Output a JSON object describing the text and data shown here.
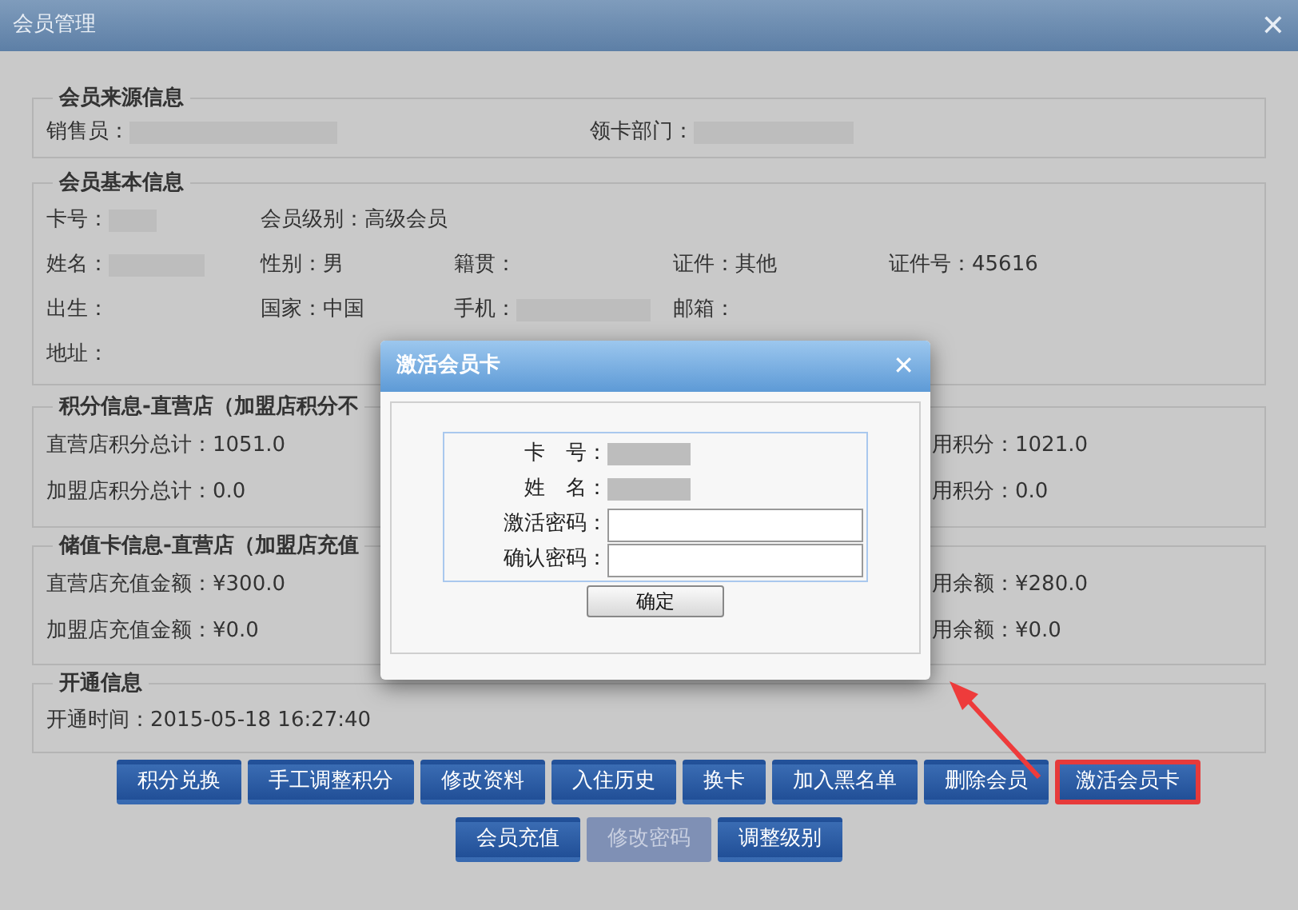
{
  "window": {
    "title": "会员管理",
    "close": "✕"
  },
  "source": {
    "legend": "会员来源信息",
    "fields": [
      {
        "label": "销售员："
      },
      {
        "label": "领卡部门："
      }
    ]
  },
  "basic": {
    "legend": "会员基本信息",
    "rows": [
      [
        {
          "label": "卡号：",
          "redacted": true
        },
        {
          "label": "会员级别：高级会员"
        }
      ],
      [
        {
          "label": "姓名：",
          "redacted": true
        },
        {
          "label": "性别：男"
        },
        {
          "label": "籍贯："
        },
        {
          "label": "证件：其他"
        },
        {
          "label": "证件号：45616"
        }
      ],
      [
        {
          "label": "出生："
        },
        {
          "label": "国家：中国"
        },
        {
          "label": "手机：",
          "redacted": true
        },
        {
          "label": "邮箱："
        }
      ],
      [
        {
          "label": "地址："
        }
      ]
    ]
  },
  "points": {
    "legend": "积分信息-直营店（加盟店积分不",
    "rows": [
      {
        "left": "直营店积分总计：1051.0",
        "right": "用积分：1021.0"
      },
      {
        "left": "加盟店积分总计：0.0",
        "right": "用积分：0.0"
      }
    ]
  },
  "stored": {
    "legend": "储值卡信息-直营店（加盟店充值",
    "rows": [
      {
        "left": "直营店充值金额：¥300.0",
        "right": "用余额：¥280.0"
      },
      {
        "left": "加盟店充值金额：¥0.0",
        "right": "用余额：¥0.0"
      }
    ]
  },
  "opening": {
    "legend": "开通信息",
    "text": "开通时间：2015-05-18 16:27:40"
  },
  "buttons": [
    [
      {
        "label": "积分兑换",
        "disabled": false,
        "highlighted": false
      },
      {
        "label": "手工调整积分",
        "disabled": false,
        "highlighted": false
      },
      {
        "label": "修改资料",
        "disabled": false,
        "highlighted": false
      },
      {
        "label": "入住历史",
        "disabled": false,
        "highlighted": false
      },
      {
        "label": "换卡",
        "disabled": false,
        "highlighted": false
      },
      {
        "label": "加入黑名单",
        "disabled": false,
        "highlighted": false
      },
      {
        "label": "删除会员",
        "disabled": false,
        "highlighted": false
      },
      {
        "label": "激活会员卡",
        "disabled": false,
        "highlighted": true
      }
    ],
    [
      {
        "label": "会员充值",
        "disabled": false,
        "highlighted": false
      },
      {
        "label": "修改密码",
        "disabled": true,
        "highlighted": false
      },
      {
        "label": "调整级别",
        "disabled": false,
        "highlighted": false
      }
    ]
  ],
  "dialog": {
    "title": "激活会员卡",
    "close": "✕",
    "fields": [
      {
        "label": "卡　号：",
        "kind": "redacted"
      },
      {
        "label": "姓　名：",
        "kind": "redacted"
      },
      {
        "label": "激活密码：",
        "kind": "input"
      },
      {
        "label": "确认密码：",
        "kind": "input"
      }
    ],
    "confirm": "确定"
  }
}
